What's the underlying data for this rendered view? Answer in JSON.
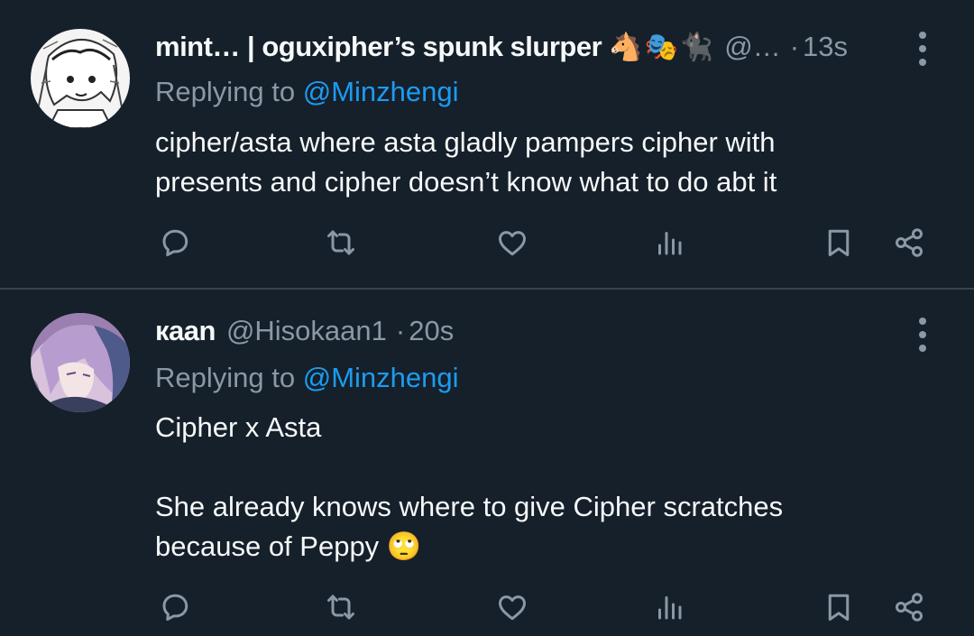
{
  "tweets": [
    {
      "display_name": "mint… | oguxipher’s spunk slurper",
      "emojis": [
        "🐴",
        "🎭",
        "🐈‍⬛"
      ],
      "handle": "@…",
      "separator": "·",
      "time": "13s",
      "replying_prefix": "Replying to ",
      "replying_to": "@Minzhengi",
      "text_lines": [
        "cipher/asta where asta gladly pampers cipher with",
        "presents and cipher doesn’t know what to do abt it"
      ]
    },
    {
      "display_name": "каan",
      "handle": "@Hisokaan1",
      "separator": "·",
      "time": "20s",
      "replying_prefix": "Replying to ",
      "replying_to": "@Minzhengi",
      "text_line1": "Cipher x Asta",
      "text_line2": "She already knows where to give Cipher scratches",
      "text_line3": "because of Peppy 🙄"
    }
  ],
  "icons": {
    "reply": "reply-icon",
    "retweet": "retweet-icon",
    "like": "heart-icon",
    "views": "views-icon",
    "bookmark": "bookmark-icon",
    "share": "share-icon",
    "more": "more-options-icon"
  },
  "colors": {
    "background": "#15202b",
    "text": "#f7f9f9",
    "muted": "#8b98a5",
    "accent": "#1d9bf0",
    "divider": "#38444d"
  }
}
